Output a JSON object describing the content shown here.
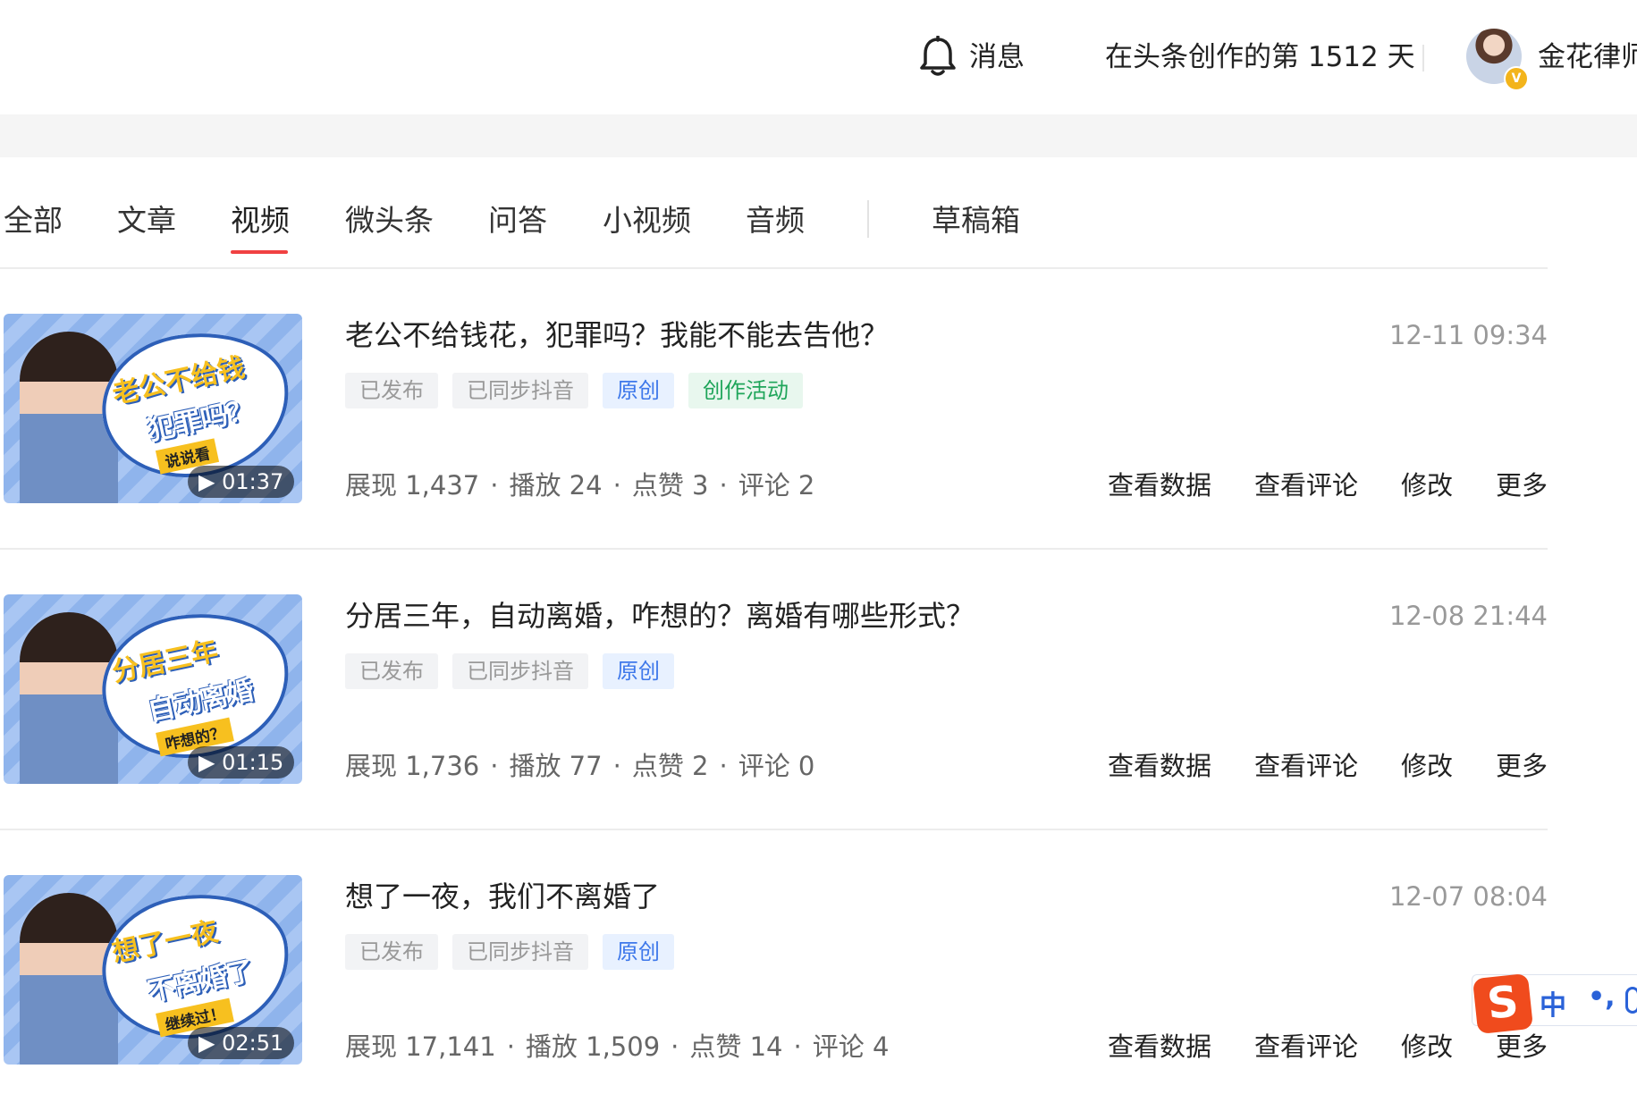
{
  "header": {
    "messages_label": "消息",
    "creation_days": "在头条创作的第 1512 天",
    "user_name": "金花律师",
    "verified_badge": "V"
  },
  "tabs": [
    {
      "label": "全部"
    },
    {
      "label": "文章"
    },
    {
      "label": "视频",
      "active": true
    },
    {
      "label": "微头条"
    },
    {
      "label": "问答"
    },
    {
      "label": "小视频"
    },
    {
      "label": "音频"
    },
    {
      "label": "草稿箱"
    }
  ],
  "items": [
    {
      "title": "老公不给钱花，犯罪吗？我能不能去告他？",
      "date": "12-11 09:34",
      "duration": "▶ 01:37",
      "thumb_text": [
        "老公不给钱",
        "犯罪吗？",
        "说说看"
      ],
      "badges": [
        {
          "label": "已发布",
          "style": "gray"
        },
        {
          "label": "已同步抖音",
          "style": "gray"
        },
        {
          "label": "原创",
          "style": "blue"
        },
        {
          "label": "创作活动",
          "style": "green"
        }
      ],
      "stats": [
        "展现 1,437",
        "播放 24",
        "点赞 3",
        "评论 2"
      ],
      "actions": [
        "查看数据",
        "查看评论",
        "修改",
        "更多"
      ]
    },
    {
      "title": "分居三年，自动离婚，咋想的？离婚有哪些形式？",
      "date": "12-08 21:44",
      "duration": "▶ 01:15",
      "thumb_text": [
        "分居三年",
        "自动离婚",
        "咋想的？"
      ],
      "badges": [
        {
          "label": "已发布",
          "style": "gray"
        },
        {
          "label": "已同步抖音",
          "style": "gray"
        },
        {
          "label": "原创",
          "style": "blue"
        }
      ],
      "stats": [
        "展现 1,736",
        "播放 77",
        "点赞 2",
        "评论 0"
      ],
      "actions": [
        "查看数据",
        "查看评论",
        "修改",
        "更多"
      ]
    },
    {
      "title": "想了一夜，我们不离婚了",
      "date": "12-07 08:04",
      "duration": "▶ 02:51",
      "thumb_text": [
        "想了一夜",
        "不离婚了",
        "继续过！"
      ],
      "badges": [
        {
          "label": "已发布",
          "style": "gray"
        },
        {
          "label": "已同步抖音",
          "style": "gray"
        },
        {
          "label": "原创",
          "style": "blue"
        }
      ],
      "stats": [
        "展现 17,141",
        "播放 1,509",
        "点赞 14",
        "评论 4"
      ],
      "actions": [
        "查看数据",
        "查看评论",
        "修改",
        "更多"
      ]
    }
  ],
  "ime": {
    "logo": "S",
    "mode": "中",
    "punct": "•,"
  },
  "colors": {
    "accent": "#f04142",
    "badge_blue": "#3e78ea",
    "badge_green": "#1fa55a",
    "muted": "#999999"
  }
}
